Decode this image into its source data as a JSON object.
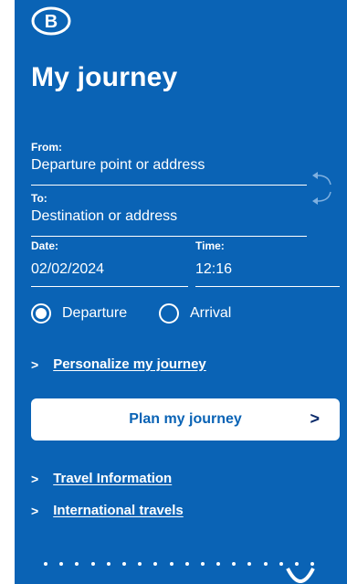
{
  "header": {
    "logo_letter": "B",
    "title": "My journey"
  },
  "form": {
    "from_label": "From:",
    "from_placeholder": "Departure point or address",
    "to_label": "To:",
    "to_placeholder": "Destination or address",
    "date_label": "Date:",
    "date_value": "02/02/2024",
    "time_label": "Time:",
    "time_value": "12:16"
  },
  "mode": {
    "departure_label": "Departure",
    "arrival_label": "Arrival",
    "selected": "Departure"
  },
  "links": {
    "personalize": "Personalize my journey",
    "travel_info": "Travel Information",
    "international": "International travels"
  },
  "actions": {
    "plan_label": "Plan my journey"
  },
  "colors": {
    "brand_blue": "#0a63b5",
    "white": "#ffffff"
  }
}
